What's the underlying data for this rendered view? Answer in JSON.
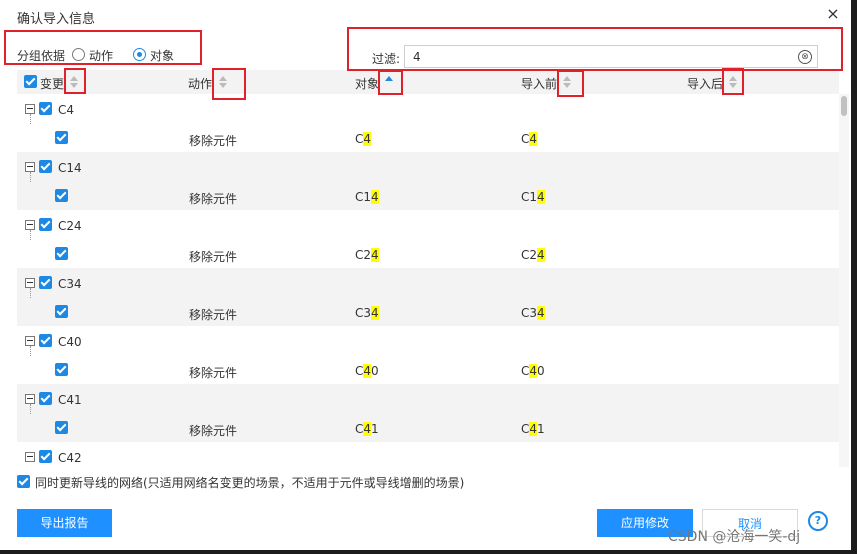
{
  "dialog": {
    "title": "确认导入信息",
    "close_icon": "×"
  },
  "grouping": {
    "label": "分组依据",
    "options": [
      {
        "label": "动作",
        "selected": false
      },
      {
        "label": "对象",
        "selected": true
      }
    ]
  },
  "filter": {
    "label": "过滤:",
    "value": "4",
    "clear_icon": "⊗"
  },
  "table": {
    "columns": [
      {
        "label": "变更",
        "sort": "none"
      },
      {
        "label": "动作",
        "sort": "none"
      },
      {
        "label": "对象",
        "sort": "asc"
      },
      {
        "label": "导入前",
        "sort": "none"
      },
      {
        "label": "导入后",
        "sort": "none"
      }
    ],
    "groups": [
      {
        "name": "C4",
        "action": "移除元件",
        "obj_pre": "C",
        "obj_hl": "4",
        "obj_post": "",
        "before_pre": "C",
        "before_hl": "4",
        "before_post": ""
      },
      {
        "name": "C14",
        "action": "移除元件",
        "obj_pre": "C1",
        "obj_hl": "4",
        "obj_post": "",
        "before_pre": "C1",
        "before_hl": "4",
        "before_post": ""
      },
      {
        "name": "C24",
        "action": "移除元件",
        "obj_pre": "C2",
        "obj_hl": "4",
        "obj_post": "",
        "before_pre": "C2",
        "before_hl": "4",
        "before_post": ""
      },
      {
        "name": "C34",
        "action": "移除元件",
        "obj_pre": "C3",
        "obj_hl": "4",
        "obj_post": "",
        "before_pre": "C3",
        "before_hl": "4",
        "before_post": ""
      },
      {
        "name": "C40",
        "action": "移除元件",
        "obj_pre": "C",
        "obj_hl": "4",
        "obj_post": "0",
        "before_pre": "C",
        "before_hl": "4",
        "before_post": "0"
      },
      {
        "name": "C41",
        "action": "移除元件",
        "obj_pre": "C",
        "obj_hl": "4",
        "obj_post": "1",
        "before_pre": "C",
        "before_hl": "4",
        "before_post": "1"
      },
      {
        "name": "C42"
      }
    ]
  },
  "sync_option": {
    "label": "同时更新导线的网络(只适用网络名变更的场景，不适用于元件或导线增删的场景)",
    "checked": true
  },
  "buttons": {
    "export": "导出报告",
    "apply": "应用修改",
    "cancel": "取消",
    "help": "?"
  },
  "watermark": "CSDN @沧海一笑-dj",
  "colors": {
    "accent": "#1e90ff",
    "highlight_box": "#e0202a",
    "match_highlight": "#ffff00"
  }
}
